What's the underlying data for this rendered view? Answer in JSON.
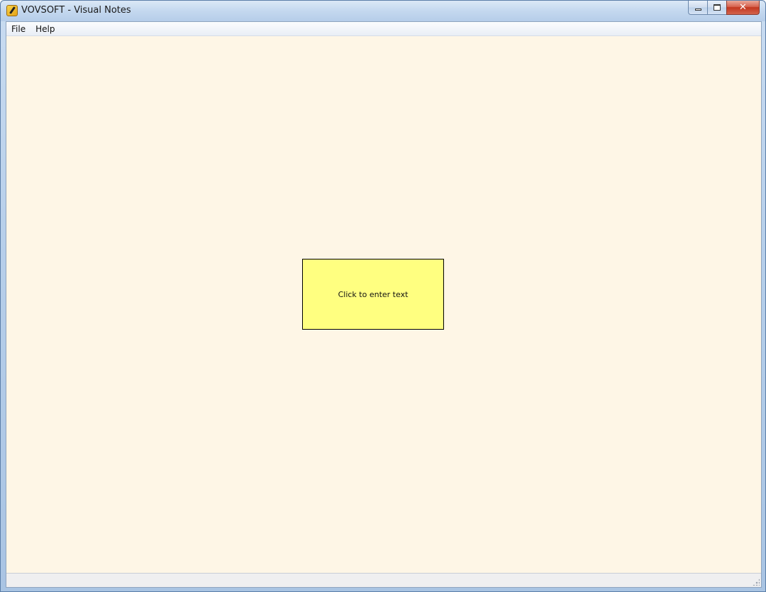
{
  "window": {
    "title": "VOVSOFT - Visual Notes",
    "icon": "pencil-notes-icon"
  },
  "caption": {
    "minimize_icon": "minimize-icon",
    "maximize_icon": "maximize-icon",
    "close_icon": "close-icon",
    "close_glyph": "✕"
  },
  "menubar": {
    "items": [
      {
        "label": "File"
      },
      {
        "label": "Help"
      }
    ]
  },
  "note": {
    "placeholder": "Click to enter text",
    "color": "#ffff80"
  },
  "colors": {
    "canvas": "#fef6e6",
    "close_button": "#c2371f"
  }
}
